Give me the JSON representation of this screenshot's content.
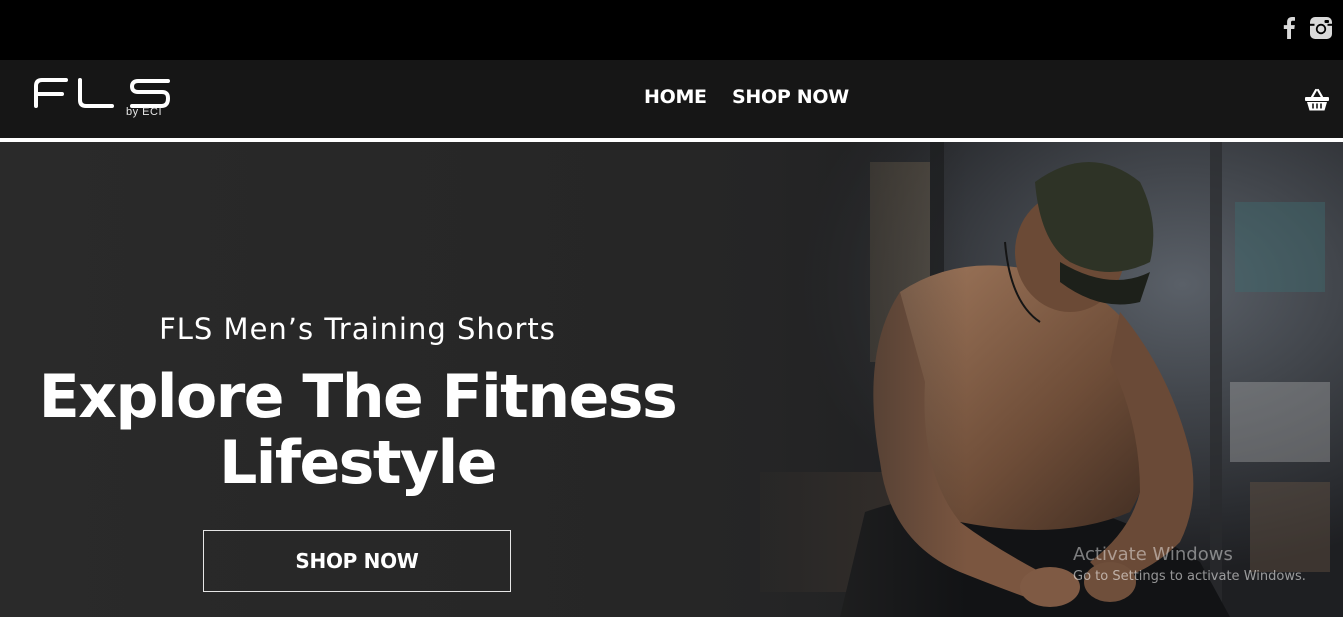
{
  "header": {
    "logo_text": "FLS",
    "logo_sub": "by ECI",
    "nav": [
      {
        "label": "HOME"
      },
      {
        "label": "SHOP NOW"
      }
    ]
  },
  "social": {
    "facebook_icon": "facebook-icon",
    "instagram_icon": "instagram-icon"
  },
  "cart_icon": "basket-icon",
  "hero": {
    "subtitle": "FLS Men’s Training Shorts",
    "headline_line1": "Explore The Fitness",
    "headline_line2": "Lifestyle",
    "cta_label": "SHOP NOW",
    "image_description": "hero-photo"
  },
  "watermark": {
    "title": "Activate Windows",
    "subtitle": "Go to Settings to activate Windows."
  },
  "colors": {
    "topbar": "#000000",
    "header": "#161616",
    "hero_bg": "#262626",
    "text": "#ffffff"
  }
}
